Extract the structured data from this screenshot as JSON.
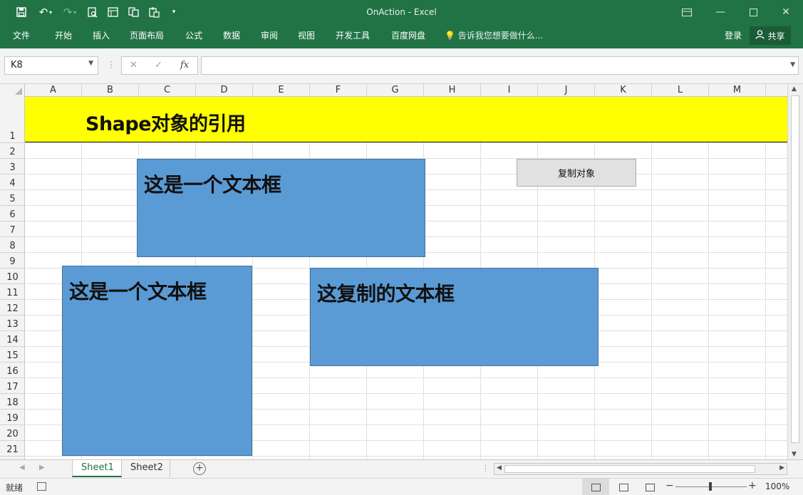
{
  "window": {
    "title": "OnAction - Excel"
  },
  "ribbon": {
    "tabs": [
      "文件",
      "开始",
      "插入",
      "页面布局",
      "公式",
      "数据",
      "审阅",
      "视图",
      "开发工具",
      "百度网盘"
    ],
    "tell_me": "告诉我您想要做什么...",
    "login": "登录",
    "share": "共享"
  },
  "formula_bar": {
    "name_box": "K8",
    "formula": "",
    "fx_label": "fx"
  },
  "grid": {
    "columns": [
      "A",
      "B",
      "C",
      "D",
      "E",
      "F",
      "G",
      "H",
      "I",
      "J",
      "K",
      "L",
      "M"
    ],
    "rows": [
      "1",
      "2",
      "3",
      "4",
      "5",
      "6",
      "7",
      "8",
      "9",
      "10",
      "11",
      "12",
      "13",
      "14",
      "15",
      "16",
      "17",
      "18",
      "19",
      "20",
      "21"
    ],
    "header_text": "Shape对象的引用",
    "header_fill": "#ffff00"
  },
  "shapes": {
    "fill": "#5b9bd5",
    "textbox_1": "这是一个文本框",
    "textbox_2": "这是一个文本框",
    "textbox_copy": "这复制的文本框"
  },
  "button": {
    "label": "复制对象"
  },
  "sheets": {
    "tabs": [
      "Sheet1",
      "Sheet2"
    ],
    "active": "Sheet1"
  },
  "status": {
    "ready": "就绪",
    "zoom": "100%"
  },
  "colors": {
    "accent": "#217346"
  }
}
